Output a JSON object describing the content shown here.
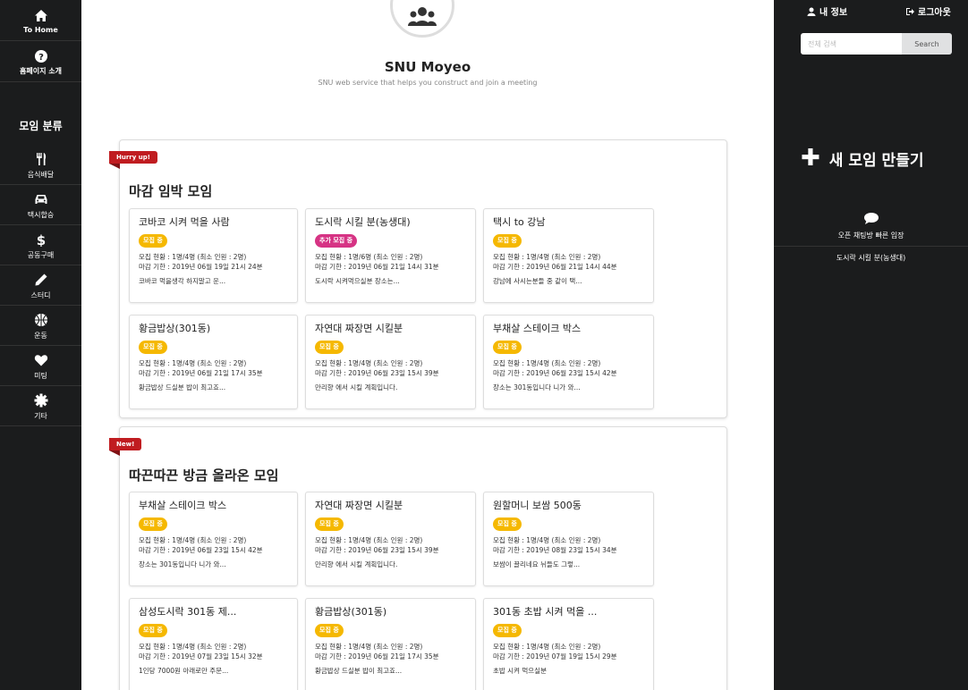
{
  "left_nav": {
    "top": [
      {
        "label": "To Home",
        "icon": "home-icon"
      },
      {
        "label": "홈페이지 소개",
        "icon": "question-icon"
      }
    ],
    "category_header": "모임 분류",
    "categories": [
      {
        "label": "음식배달",
        "icon": "utensils-icon"
      },
      {
        "label": "택시합승",
        "icon": "car-icon"
      },
      {
        "label": "공동구매",
        "icon": "dollar-icon"
      },
      {
        "label": "스터디",
        "icon": "pencil-icon"
      },
      {
        "label": "운동",
        "icon": "basketball-icon"
      },
      {
        "label": "미팅",
        "icon": "heart-icon"
      },
      {
        "label": "기타",
        "icon": "certificate-icon"
      }
    ]
  },
  "brand": {
    "title": "SNU Moyeo",
    "subtitle": "SNU web service that helps you construct and join a meeting"
  },
  "sections": [
    {
      "ribbon": "Hurry up!",
      "title": "마감 임박 모임",
      "cards": [
        {
          "title": "코바코 시켜 먹을 사람",
          "badge": "모집 중",
          "badge_type": "open",
          "members": "모집 현황 : 1명/4명  (최소 인원 : 2명)",
          "deadline": "마감 기한 : 2019년 06월 19일 21시 24분",
          "desc": "코바코 먹을생각 하지말고 운..."
        },
        {
          "title": "도시락 시킬 분(농생대)",
          "badge": "추가 모집 중",
          "badge_type": "extra",
          "members": "모집 현황 : 1명/6명  (최소 인원 : 2명)",
          "deadline": "마감 기한 : 2019년 06월 21일 14시 31분",
          "desc": "도시락 시켜먹으실분 장소는..."
        },
        {
          "title": "택시 to 강남",
          "badge": "모집 중",
          "badge_type": "open",
          "members": "모집 현황 : 1명/4명  (최소 인원 : 2명)",
          "deadline": "마감 기한 : 2019년 06월 21일 14시 44분",
          "desc": "강남에 사시는분들 중 같이 택..."
        },
        {
          "title": "황금밥상(301동)",
          "badge": "모집 중",
          "badge_type": "open",
          "members": "모집 현황 : 1명/4명  (최소 인원 : 2명)",
          "deadline": "마감 기한 : 2019년 06월 21일 17시 35분",
          "desc": "황금밥상 드실분 밥이 최고죠..."
        },
        {
          "title": "자연대 짜장면 시킬분",
          "badge": "모집 중",
          "badge_type": "open",
          "members": "모집 현황 : 1명/4명  (최소 인원 : 2명)",
          "deadline": "마감 기한 : 2019년 06월 23일 15시 39분",
          "desc": "만리향 에서 시킬 계획입니다."
        },
        {
          "title": "부채살 스테이크 박스",
          "badge": "모집 중",
          "badge_type": "open",
          "members": "모집 현황 : 1명/4명  (최소 인원 : 2명)",
          "deadline": "마감 기한 : 2019년 06월 23일 15시 42분",
          "desc": "장소는 301동입니다 니가 와..."
        }
      ]
    },
    {
      "ribbon": "New!",
      "title": "따끈따끈 방금 올라온 모임",
      "cards": [
        {
          "title": "부채살 스테이크 박스",
          "badge": "모집 중",
          "badge_type": "open",
          "members": "모집 현황 : 1명/4명  (최소 인원 : 2명)",
          "deadline": "마감 기한 : 2019년 06월 23일 15시 42분",
          "desc": "장소는 301동입니다 니가 와..."
        },
        {
          "title": "자연대 짜장면 시킬분",
          "badge": "모집 중",
          "badge_type": "open",
          "members": "모집 현황 : 1명/4명  (최소 인원 : 2명)",
          "deadline": "마감 기한 : 2019년 06월 23일 15시 39분",
          "desc": "만리향 에서 시킬 계획입니다."
        },
        {
          "title": "원할머니 보쌈 500동",
          "badge": "모집 중",
          "badge_type": "open",
          "members": "모집 현황 : 1명/4명  (최소 인원 : 2명)",
          "deadline": "마감 기한 : 2019년 08월 23일 15시 34분",
          "desc": "보쌈이 끌리네요 뉘들도 그렇..."
        },
        {
          "title": "삼성도시락 301동 제...",
          "badge": "모집 중",
          "badge_type": "open",
          "members": "모집 현황 : 1명/4명  (최소 인원 : 2명)",
          "deadline": "마감 기한 : 2019년 07월 23일 15시 32분",
          "desc": "1인당 7000원 아래로만 주문..."
        },
        {
          "title": "황금밥상(301동)",
          "badge": "모집 중",
          "badge_type": "open",
          "members": "모집 현황 : 1명/4명  (최소 인원 : 2명)",
          "deadline": "마감 기한 : 2019년 06월 21일 17시 35분",
          "desc": "황금밥상 드실분 밥이 최고죠..."
        },
        {
          "title": "301동 초밥 시켜 먹을 ...",
          "badge": "모집 중",
          "badge_type": "open",
          "members": "모집 현황 : 1명/4명  (최소 인원 : 2명)",
          "deadline": "마감 기한 : 2019년 07월 19일 15시 29분",
          "desc": "초밥 시켜 먹으실분"
        }
      ]
    }
  ],
  "right_panel": {
    "my_info": "내 정보",
    "logout": "로그아웃",
    "search_placeholder": "전체 검색",
    "search_button": "Search",
    "create_meeting": "새 모임 만들기",
    "chat_quick_enter": "오픈 채팅방 빠른 입장",
    "chat_room": "도시락 시킬 분(농생대)"
  },
  "colors": {
    "sidebar_bg": "#1b1c1d",
    "ribbon_red": "#c01c20",
    "badge_yellow": "#f5b800",
    "badge_pink": "#d63384"
  }
}
